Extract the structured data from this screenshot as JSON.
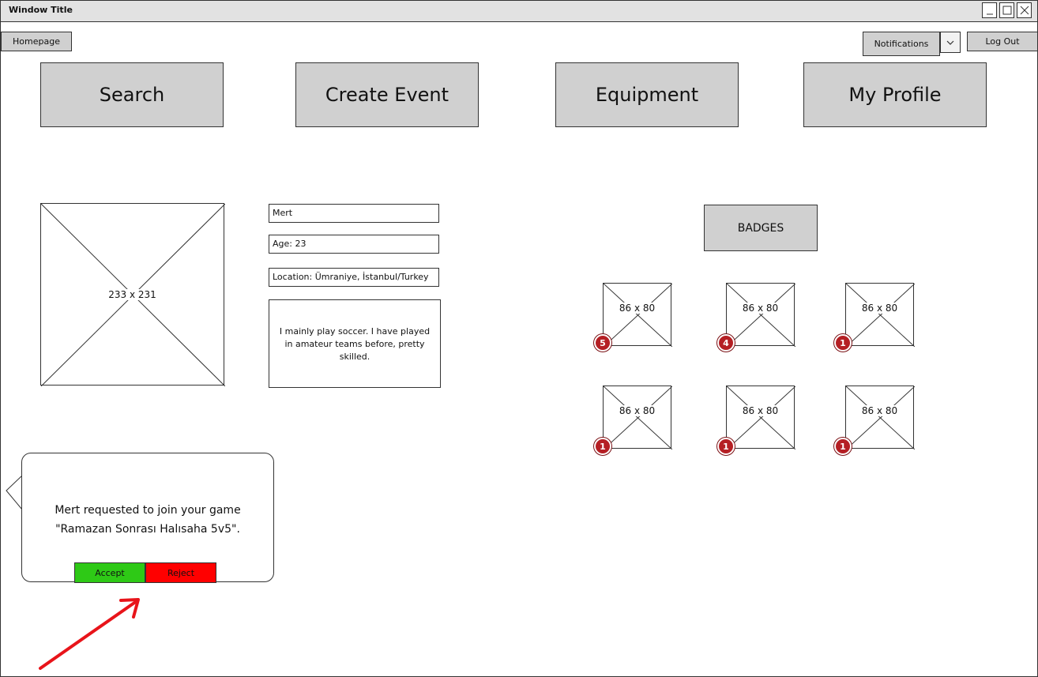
{
  "window": {
    "title": "Window Title"
  },
  "topbar": {
    "homepage": "Homepage",
    "notifications": "Notifications",
    "logout": "Log Out"
  },
  "nav": {
    "search": "Search",
    "create_event": "Create Event",
    "equipment": "Equipment",
    "my_profile": "My Profile"
  },
  "profile": {
    "photo_placeholder": "233 x 231",
    "name": "Mert",
    "age": "Age: 23",
    "location": "Location: Ümraniye, İstanbul/Turkey",
    "bio": "I mainly play soccer. I have played in amateur teams before, pretty skilled."
  },
  "badges": {
    "title": "BADGES",
    "items": [
      {
        "placeholder": "86 x 80",
        "count": "5"
      },
      {
        "placeholder": "86 x 80",
        "count": "4"
      },
      {
        "placeholder": "86 x 80",
        "count": "1"
      },
      {
        "placeholder": "86 x 80",
        "count": "1"
      },
      {
        "placeholder": "86 x 80",
        "count": "1"
      },
      {
        "placeholder": "86 x 80",
        "count": "1"
      }
    ]
  },
  "notification": {
    "line1": "Mert requested to join your game",
    "line2": "\"Ramazan Sonrası Halısaha 5v5\".",
    "accept": "Accept",
    "reject": "Reject"
  },
  "colors": {
    "accept": "#2ec916",
    "reject": "#ff0000",
    "badge": "#b51f24",
    "arrow": "#e8141a"
  }
}
